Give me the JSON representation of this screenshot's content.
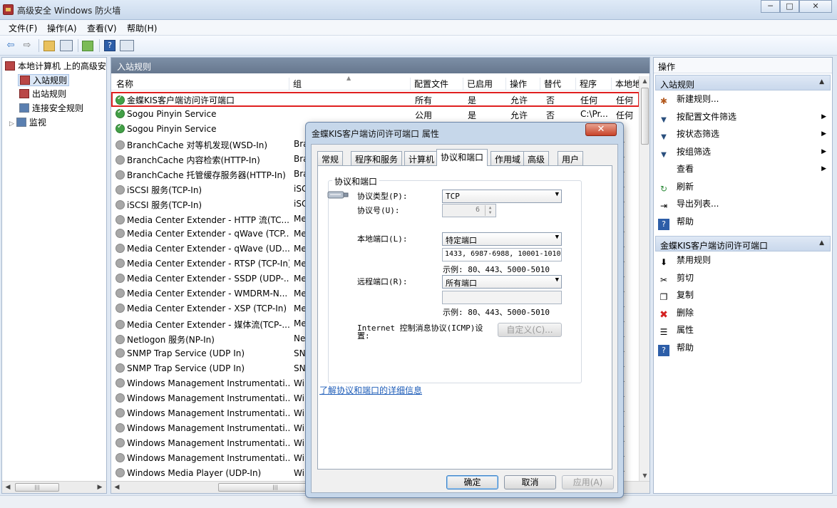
{
  "window": {
    "title": "高级安全 Windows 防火墙",
    "min": "─",
    "max": "□",
    "close": "✕"
  },
  "menu": [
    "文件(F)",
    "操作(A)",
    "查看(V)",
    "帮助(H)"
  ],
  "toolbar": {
    "back": "⇦",
    "forward": "⇨"
  },
  "tree": {
    "root": "本地计算机 上的高级安",
    "items": [
      "入站规则",
      "出站规则",
      "连接安全规则",
      "监视"
    ]
  },
  "center": {
    "title": "入站规则",
    "columns": [
      "名称",
      "组",
      "配置文件",
      "已启用",
      "操作",
      "替代",
      "程序",
      "本地地"
    ],
    "rows": [
      {
        "name": "金蝶KIS客户端访问许可端口",
        "group": "",
        "profile": "所有",
        "enabled": "是",
        "action": "允许",
        "override": "否",
        "program": "任何",
        "local": "任何",
        "on": true
      },
      {
        "name": "Sogou Pinyin Service",
        "group": "",
        "profile": "公用",
        "enabled": "是",
        "action": "允许",
        "override": "否",
        "program": "C:\\Pr...",
        "local": "任何",
        "on": true
      },
      {
        "name": "Sogou Pinyin Service",
        "group": "",
        "profile": "",
        "enabled": "",
        "action": "",
        "override": "",
        "program": "",
        "local": "",
        "on": true
      },
      {
        "name": "BranchCache 对等机发现(WSD-In)",
        "group": "Bra",
        "profile": "",
        "enabled": "",
        "action": "",
        "override": "",
        "program": "",
        "local": "何",
        "on": false
      },
      {
        "name": "BranchCache 内容检索(HTTP-In)",
        "group": "Bra",
        "profile": "",
        "enabled": "",
        "action": "",
        "override": "",
        "program": "",
        "local": "何",
        "on": false
      },
      {
        "name": "BranchCache 托管缓存服务器(HTTP-In)",
        "group": "Bra",
        "profile": "",
        "enabled": "",
        "action": "",
        "override": "",
        "program": "",
        "local": "何",
        "on": false
      },
      {
        "name": "iSCSI 服务(TCP-In)",
        "group": "iSC",
        "profile": "",
        "enabled": "",
        "action": "",
        "override": "",
        "program": "",
        "local": "何",
        "on": false
      },
      {
        "name": "iSCSI 服务(TCP-In)",
        "group": "iSC",
        "profile": "",
        "enabled": "",
        "action": "",
        "override": "",
        "program": "",
        "local": "何",
        "on": false
      },
      {
        "name": "Media Center Extender - HTTP 流(TC...",
        "group": "Me",
        "profile": "",
        "enabled": "",
        "action": "",
        "override": "",
        "program": "",
        "local": "何",
        "on": false
      },
      {
        "name": "Media Center Extender - qWave (TCP...",
        "group": "Me",
        "profile": "",
        "enabled": "",
        "action": "",
        "override": "",
        "program": "",
        "local": "何",
        "on": false
      },
      {
        "name": "Media Center Extender - qWave (UD...",
        "group": "Me",
        "profile": "",
        "enabled": "",
        "action": "",
        "override": "",
        "program": "",
        "local": "何",
        "on": false
      },
      {
        "name": "Media Center Extender - RTSP (TCP-In)",
        "group": "Me",
        "profile": "",
        "enabled": "",
        "action": "",
        "override": "",
        "program": "",
        "local": "何",
        "on": false
      },
      {
        "name": "Media Center Extender - SSDP (UDP-...",
        "group": "Me",
        "profile": "",
        "enabled": "",
        "action": "",
        "override": "",
        "program": "",
        "local": "何",
        "on": false
      },
      {
        "name": "Media Center Extender - WMDRM-N...",
        "group": "Me",
        "profile": "",
        "enabled": "",
        "action": "",
        "override": "",
        "program": "",
        "local": "何",
        "on": false
      },
      {
        "name": "Media Center Extender - XSP (TCP-In)",
        "group": "Me",
        "profile": "",
        "enabled": "",
        "action": "",
        "override": "",
        "program": "",
        "local": "何",
        "on": false
      },
      {
        "name": "Media Center Extender - 媒体流(TCP-...",
        "group": "Me",
        "profile": "",
        "enabled": "",
        "action": "",
        "override": "",
        "program": "",
        "local": "何",
        "on": false
      },
      {
        "name": "Netlogon 服务(NP-In)",
        "group": "Ne",
        "profile": "",
        "enabled": "",
        "action": "",
        "override": "",
        "program": "",
        "local": "何",
        "on": false
      },
      {
        "name": "SNMP Trap Service (UDP In)",
        "group": "SN",
        "profile": "",
        "enabled": "",
        "action": "",
        "override": "",
        "program": "",
        "local": "何",
        "on": false
      },
      {
        "name": "SNMP Trap Service (UDP In)",
        "group": "SN",
        "profile": "",
        "enabled": "",
        "action": "",
        "override": "",
        "program": "",
        "local": "何",
        "on": false
      },
      {
        "name": "Windows Management Instrumentati...",
        "group": "Wi",
        "profile": "",
        "enabled": "",
        "action": "",
        "override": "",
        "program": "",
        "local": "何",
        "on": false
      },
      {
        "name": "Windows Management Instrumentati...",
        "group": "Wi",
        "profile": "",
        "enabled": "",
        "action": "",
        "override": "",
        "program": "",
        "local": "何",
        "on": false
      },
      {
        "name": "Windows Management Instrumentati...",
        "group": "Wi",
        "profile": "",
        "enabled": "",
        "action": "",
        "override": "",
        "program": "",
        "local": "何",
        "on": false
      },
      {
        "name": "Windows Management Instrumentati...",
        "group": "Wi",
        "profile": "",
        "enabled": "",
        "action": "",
        "override": "",
        "program": "",
        "local": "何",
        "on": false
      },
      {
        "name": "Windows Management Instrumentati...",
        "group": "Wi",
        "profile": "",
        "enabled": "",
        "action": "",
        "override": "",
        "program": "",
        "local": "何",
        "on": false
      },
      {
        "name": "Windows Management Instrumentati...",
        "group": "Wi",
        "profile": "",
        "enabled": "",
        "action": "",
        "override": "",
        "program": "",
        "local": "何",
        "on": false
      },
      {
        "name": "Windows Media Player (UDP-In)",
        "group": "Wi",
        "profile": "",
        "enabled": "",
        "action": "",
        "override": "",
        "program": "",
        "local": "何",
        "on": false
      }
    ]
  },
  "actions": {
    "title": "操作",
    "section1": "入站规则",
    "items1": [
      {
        "label": "新建规则...",
        "icon": "new-rule-icon",
        "glyph": "✱",
        "sub": false
      },
      {
        "label": "按配置文件筛选",
        "icon": "filter-icon",
        "glyph": "▼",
        "sub": true
      },
      {
        "label": "按状态筛选",
        "icon": "filter-icon",
        "glyph": "▼",
        "sub": true
      },
      {
        "label": "按组筛选",
        "icon": "filter-icon",
        "glyph": "▼",
        "sub": true
      },
      {
        "label": "查看",
        "icon": "",
        "glyph": "",
        "sub": true
      },
      {
        "label": "刷新",
        "icon": "refresh-icon",
        "glyph": "↻",
        "sub": false
      },
      {
        "label": "导出列表...",
        "icon": "export-icon",
        "glyph": "⇥",
        "sub": false
      },
      {
        "label": "帮助",
        "icon": "help-icon",
        "glyph": "?",
        "sub": false
      }
    ],
    "section2": "金蝶KIS客户端访问许可端口",
    "items2": [
      {
        "label": "禁用规则",
        "icon": "disable-icon",
        "glyph": "⬇"
      },
      {
        "label": "剪切",
        "icon": "cut-icon",
        "glyph": "✂"
      },
      {
        "label": "复制",
        "icon": "copy-icon",
        "glyph": "❐"
      },
      {
        "label": "删除",
        "icon": "delete-icon",
        "glyph": "✖"
      },
      {
        "label": "属性",
        "icon": "properties-icon",
        "glyph": "☰"
      },
      {
        "label": "帮助",
        "icon": "help-icon",
        "glyph": "?"
      }
    ]
  },
  "dialog": {
    "title": "金蝶KIS客户端访问许可端口 属性",
    "close": "✕",
    "tabs": [
      "常规",
      "程序和服务",
      "计算机",
      "协议和端口",
      "作用域",
      "高级",
      "用户"
    ],
    "group_label": "协议和端口",
    "protocol_type_label": "协议类型(P):",
    "protocol_type_value": "TCP",
    "protocol_number_label": "协议号(U):",
    "protocol_number_value": "6",
    "local_port_label": "本地端口(L):",
    "local_port_value": "特定端口",
    "local_port_input": "1433, 6987-6988, 10001-10100",
    "example1": "示例: 80、443、5000-5010",
    "remote_port_label": "远程端口(R):",
    "remote_port_value": "所有端口",
    "remote_port_input": "",
    "example2": "示例: 80、443、5000-5010",
    "icmp_label": "Internet 控制消息协议(ICMP)设置:",
    "customize": "自定义(C)...",
    "learn_more": "了解协议和端口的详细信息",
    "ok": "确定",
    "cancel": "取消",
    "apply": "应用(A)"
  }
}
